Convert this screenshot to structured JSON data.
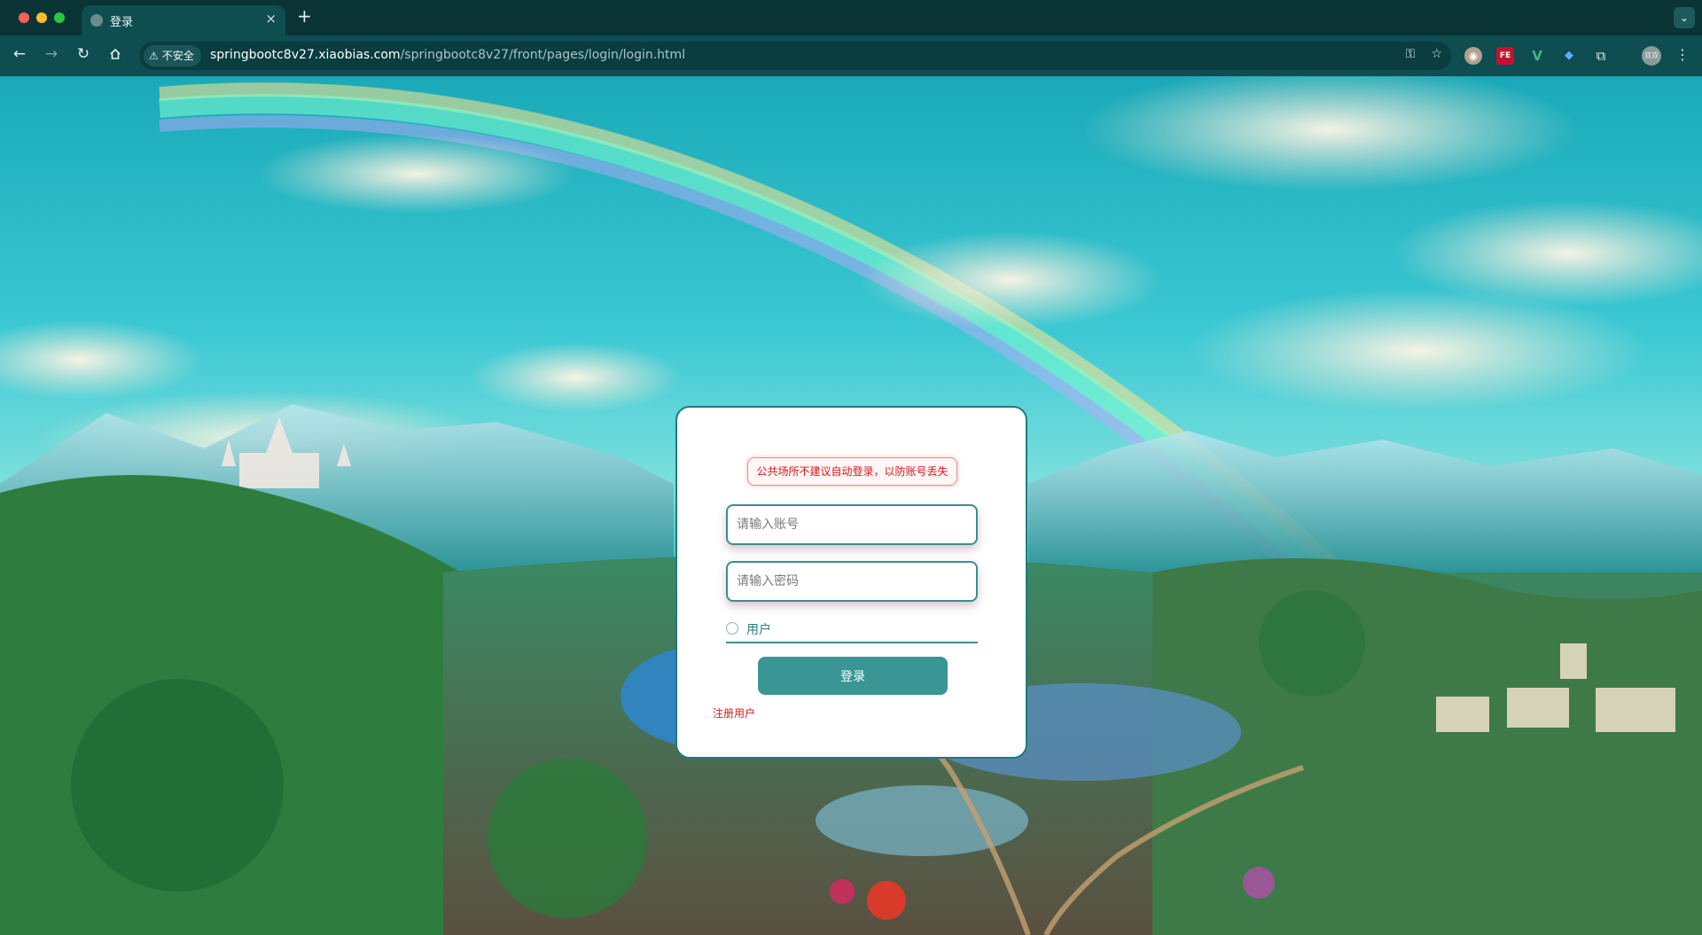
{
  "browser": {
    "tab_title": "登录",
    "new_tab": "+",
    "tab_close": "×",
    "security_label": "不安全",
    "url_host": "springbootc8v27.xiaobias.com",
    "url_path": "/springbootc8v27/front/pages/login/login.html",
    "extensions": [
      "owl-extension-icon",
      "fe-extension-icon",
      "vue-devtools-icon",
      "gem-extension-icon",
      "puzzle-icon"
    ],
    "ext_fe_label": "FE",
    "ext_vue_label": "V",
    "profile_label": "双双"
  },
  "login": {
    "notice": "公共场所不建议自动登录，以防账号丢失",
    "username_placeholder": "请输入账号",
    "password_placeholder": "请输入密码",
    "role_option": "用户",
    "login_button": "登录",
    "register_link": "注册用户"
  },
  "colors": {
    "accent": "#3a9595",
    "card_border": "#1e7a80",
    "warning_text": "#d61a1a"
  }
}
